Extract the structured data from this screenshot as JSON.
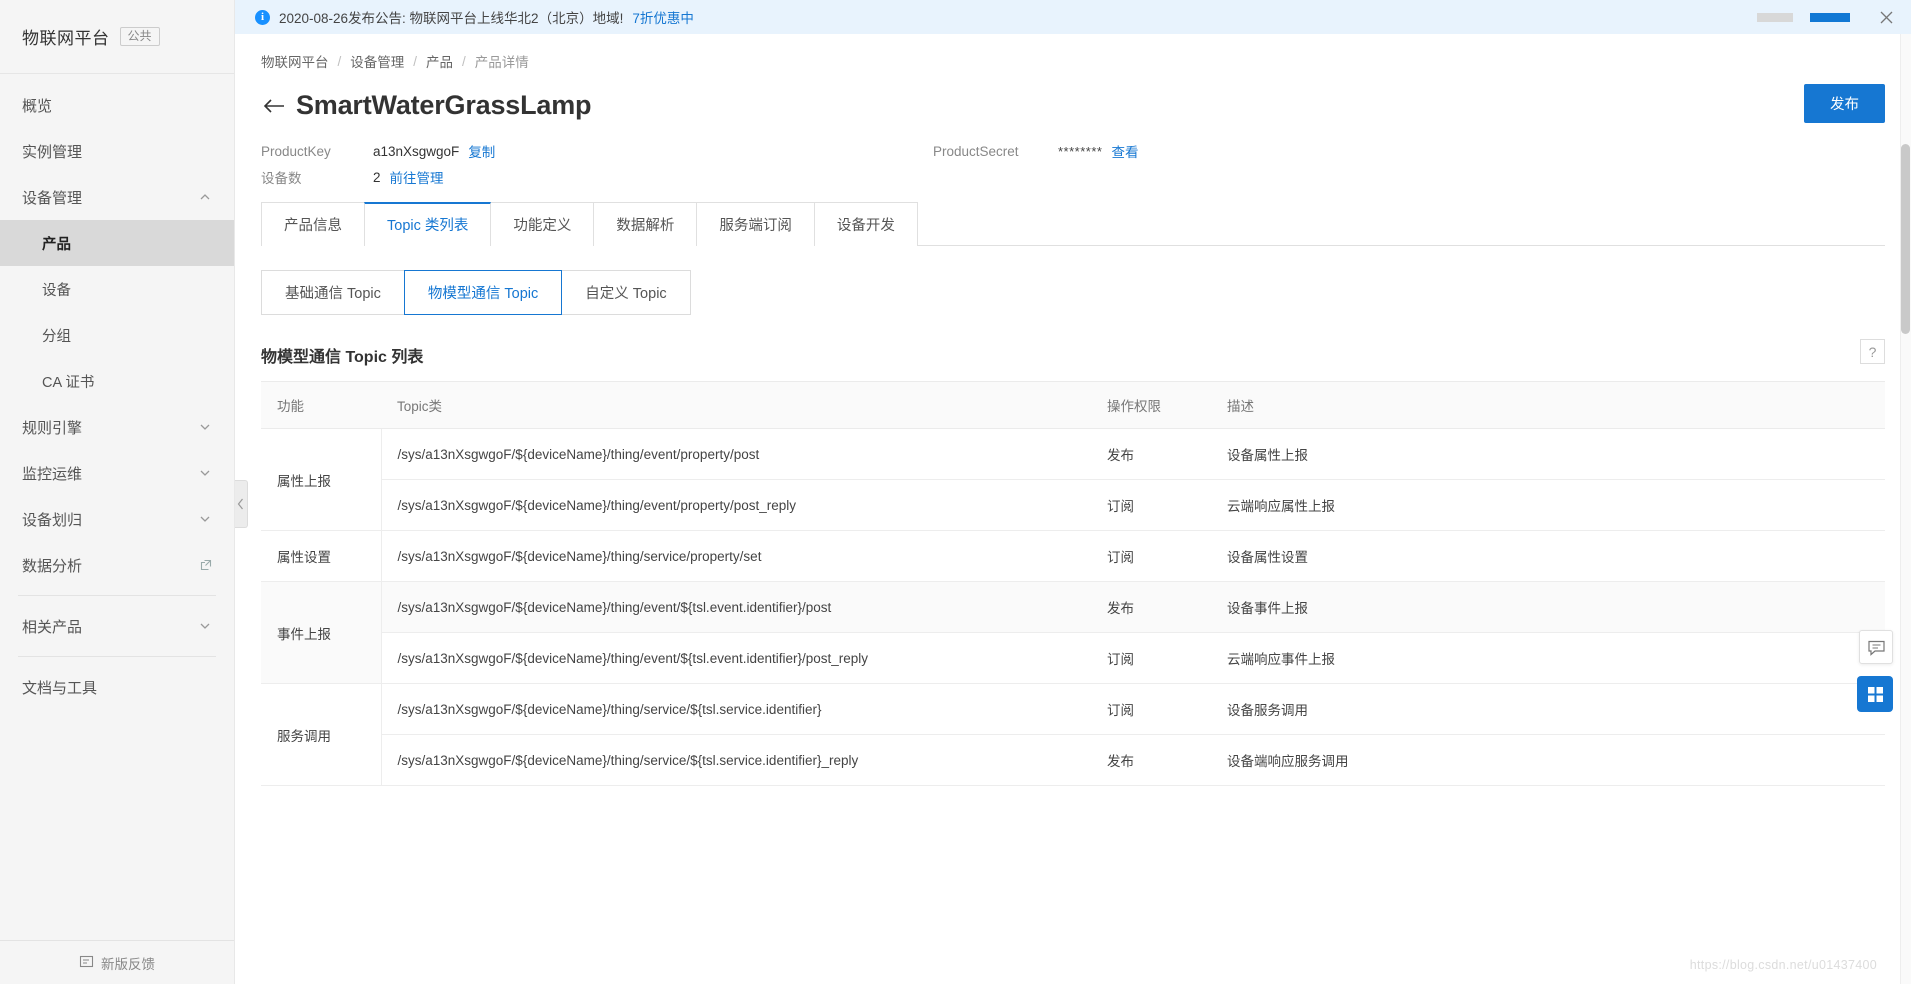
{
  "sidebar": {
    "brand": {
      "name": "物联网平台",
      "tag": "公共"
    },
    "items": [
      {
        "label": "概览",
        "type": "item",
        "icon": "none"
      },
      {
        "label": "实例管理",
        "type": "item",
        "icon": "none"
      },
      {
        "label": "设备管理",
        "type": "group",
        "icon": "chevron-up-icon",
        "expanded": true
      },
      {
        "label": "产品",
        "type": "sub",
        "active": true
      },
      {
        "label": "设备",
        "type": "sub",
        "active": false
      },
      {
        "label": "分组",
        "type": "sub",
        "active": false
      },
      {
        "label": "CA 证书",
        "type": "sub",
        "active": false
      },
      {
        "label": "规则引擎",
        "type": "group",
        "icon": "chevron-down-icon"
      },
      {
        "label": "监控运维",
        "type": "group",
        "icon": "chevron-down-icon"
      },
      {
        "label": "设备划归",
        "type": "group",
        "icon": "chevron-down-icon"
      },
      {
        "label": "数据分析",
        "type": "item",
        "icon": "external-link-icon"
      },
      {
        "label": "相关产品",
        "type": "group",
        "icon": "chevron-down-icon"
      },
      {
        "label": "文档与工具",
        "type": "item",
        "icon": "none"
      }
    ],
    "footer": {
      "label": "新版反馈",
      "icon": "feedback-icon"
    }
  },
  "notice": {
    "icon": "info-icon",
    "text": "2020-08-26发布公告: 物联网平台上线华北2（北京）地域!",
    "link": "7折优惠中",
    "close_icon": "close-icon"
  },
  "breadcrumb": [
    "物联网平台",
    "设备管理",
    "产品",
    "产品详情"
  ],
  "header": {
    "back_icon": "back-arrow-icon",
    "title": "SmartWaterGrassLamp",
    "publish_button": "发布"
  },
  "meta": {
    "product_key_label": "ProductKey",
    "product_key_value": "a13nXsgwgoF",
    "copy_link": "复制",
    "device_count_label": "设备数",
    "device_count_value": "2",
    "manage_link": "前往管理",
    "product_secret_label": "ProductSecret",
    "product_secret_value": "********",
    "view_link": "查看"
  },
  "tabs": [
    {
      "label": "产品信息",
      "active": false
    },
    {
      "label": "Topic 类列表",
      "active": true
    },
    {
      "label": "功能定义",
      "active": false
    },
    {
      "label": "数据解析",
      "active": false
    },
    {
      "label": "服务端订阅",
      "active": false
    },
    {
      "label": "设备开发",
      "active": false
    }
  ],
  "subtabs": [
    {
      "label": "基础通信 Topic",
      "active": false
    },
    {
      "label": "物模型通信 Topic",
      "active": true
    },
    {
      "label": "自定义 Topic",
      "active": false
    }
  ],
  "section": {
    "title": "物模型通信 Topic 列表",
    "help_icon": "question-mark-icon",
    "help_label": "?"
  },
  "table": {
    "columns": [
      "功能",
      "Topic类",
      "操作权限",
      "描述"
    ],
    "rows": [
      {
        "function": "属性上报",
        "rowspan": 2,
        "entries": [
          {
            "topic": "/sys/a13nXsgwgoF/${deviceName}/thing/event/property/post",
            "permission": "发布",
            "desc": "设备属性上报"
          },
          {
            "topic": "/sys/a13nXsgwgoF/${deviceName}/thing/event/property/post_reply",
            "permission": "订阅",
            "desc": "云端响应属性上报"
          }
        ]
      },
      {
        "function": "属性设置",
        "rowspan": 1,
        "entries": [
          {
            "topic": "/sys/a13nXsgwgoF/${deviceName}/thing/service/property/set",
            "permission": "订阅",
            "desc": "设备属性设置"
          }
        ]
      },
      {
        "function": "事件上报",
        "rowspan": 2,
        "entries": [
          {
            "topic": "/sys/a13nXsgwgoF/${deviceName}/thing/event/${tsl.event.identifier}/post",
            "permission": "发布",
            "desc": "设备事件上报"
          },
          {
            "topic": "/sys/a13nXsgwgoF/${deviceName}/thing/event/${tsl.event.identifier}/post_reply",
            "permission": "订阅",
            "desc": "云端响应事件上报"
          }
        ]
      },
      {
        "function": "服务调用",
        "rowspan": 2,
        "entries": [
          {
            "topic": "/sys/a13nXsgwgoF/${deviceName}/thing/service/${tsl.service.identifier}",
            "permission": "订阅",
            "desc": "设备服务调用"
          },
          {
            "topic": "/sys/a13nXsgwgoF/${deviceName}/thing/service/${tsl.service.identifier}_reply",
            "permission": "发布",
            "desc": "设备端响应服务调用"
          }
        ]
      }
    ]
  },
  "floating": {
    "chat_icon": "chat-bubble-icon",
    "grid_icon": "grid-apps-icon"
  },
  "watermark": "https://blog.csdn.net/u01437400",
  "colors": {
    "accent": "#1677d2",
    "notice_bg": "#e8f3fd",
    "sidebar_bg": "#f5f5f5"
  }
}
